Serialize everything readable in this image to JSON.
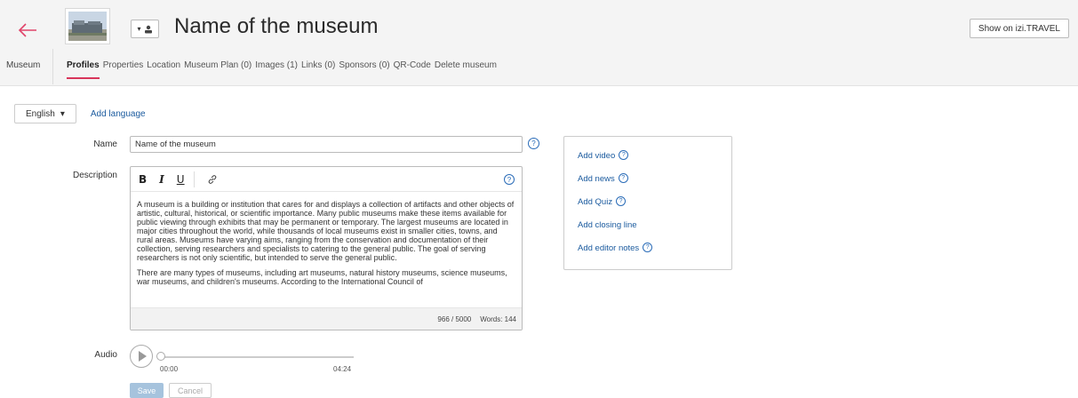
{
  "header": {
    "title": "Name of the museum",
    "show_button": "Show on izi.TRAVEL",
    "museum_link": "Museum",
    "accent_color": "#d8355a",
    "back_color": "#e0446a"
  },
  "tabs": [
    {
      "label": "Profiles",
      "active": true
    },
    {
      "label": "Properties"
    },
    {
      "label": "Location"
    },
    {
      "label": "Museum Plan (0)"
    },
    {
      "label": "Images (1)"
    },
    {
      "label": "Links (0)"
    },
    {
      "label": "Sponsors (0)"
    },
    {
      "label": "QR-Code"
    },
    {
      "label": "Delete museum"
    }
  ],
  "language": {
    "selected": "English",
    "add_label": "Add language"
  },
  "form": {
    "name_label": "Name",
    "name_value": "Name of the museum",
    "description_label": "Description",
    "description_paragraphs": [
      "A museum is a building or institution that cares for and displays a collection of artifacts and other objects of artistic, cultural, historical, or scientific importance. Many public museums make these items available for public viewing through exhibits that may be permanent or temporary. The largest museums are located in major cities throughout the world, while thousands of local museums exist in smaller cities, towns, and rural areas. Museums have varying aims, ranging from the conservation and documentation of their collection, serving researchers and specialists to catering to the general public. The goal of serving researchers is not only scientific, but intended to serve the general public.",
      "There are many types of museums, including art museums, natural history museums, science museums, war museums, and children's museums. According to the International Council of"
    ],
    "char_count": "966 / 5000",
    "word_count": "Words: 144",
    "audio_label": "Audio",
    "audio_current": "00:00",
    "audio_total": "04:24",
    "save_label": "Save",
    "cancel_label": "Cancel"
  },
  "side_panel": {
    "items": [
      "Add video",
      "Add news",
      "Add Quiz",
      "Add closing line",
      "Add editor notes"
    ],
    "help_flags": [
      true,
      true,
      true,
      false,
      true
    ]
  },
  "icons": {
    "help": "?",
    "bold": "B",
    "italic": "I",
    "underline": "U",
    "link": "link-icon"
  }
}
